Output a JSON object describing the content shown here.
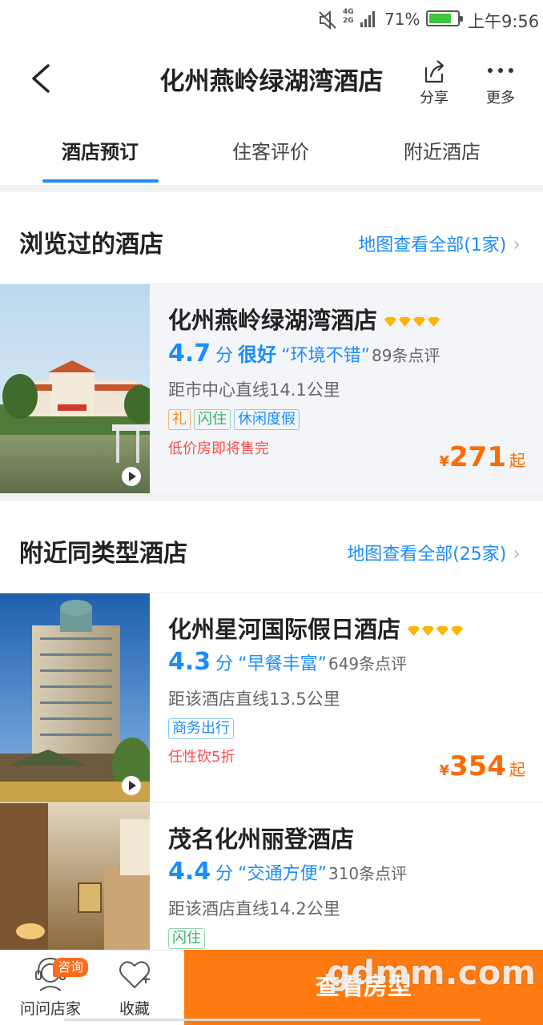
{
  "status_bar": {
    "network": "4G\n2G",
    "battery_percent": "71%",
    "battery_level": 0.71,
    "time": "上午9:56"
  },
  "header": {
    "title": "化州燕岭绿湖湾酒店",
    "share_label": "分享",
    "more_label": "更多"
  },
  "tabs": [
    {
      "label": "酒店预订",
      "active": true
    },
    {
      "label": "住客评价",
      "active": false
    },
    {
      "label": "附近酒店",
      "active": false
    }
  ],
  "viewed_section": {
    "title": "浏览过的酒店",
    "map_link": "地图查看全部(1家)"
  },
  "nearby_section": {
    "title": "附近同类型酒店",
    "map_link": "地图查看全部(25家)"
  },
  "hotels": [
    {
      "name": "化州燕岭绿湖湾酒店",
      "diamonds": 4,
      "score": "4.7",
      "score_unit": "分",
      "level": "很好",
      "highlight": "“环境不错”",
      "reviews": "89条点评",
      "distance": "距市中心直线14.1公里",
      "tags": [
        {
          "text": "礼",
          "color": "orange"
        },
        {
          "text": "闪住",
          "color": "green"
        },
        {
          "text": "休闲度假",
          "color": "blue"
        }
      ],
      "promo": "低价房即将售完",
      "price_symbol": "¥",
      "price": "271",
      "price_suffix": "起"
    },
    {
      "name": "化州星河国际假日酒店",
      "diamonds": 4,
      "score": "4.3",
      "score_unit": "分",
      "level": "",
      "highlight": "“早餐丰富”",
      "reviews": "649条点评",
      "distance": "距该酒店直线13.5公里",
      "tags": [
        {
          "text": "商务出行",
          "color": "blue"
        }
      ],
      "promo": "任性砍5折",
      "price_symbol": "¥",
      "price": "354",
      "price_suffix": "起"
    },
    {
      "name": "茂名化州丽登酒店",
      "diamonds": 0,
      "score": "4.4",
      "score_unit": "分",
      "level": "",
      "highlight": "“交通方便”",
      "reviews": "310条点评",
      "distance": "距该酒店直线14.2公里",
      "tags": [
        {
          "text": "闪住",
          "color": "green"
        }
      ],
      "promo": "",
      "price_symbol": "",
      "price": "",
      "price_suffix": ""
    }
  ],
  "bottom_bar": {
    "ask_label": "问问店家",
    "consult_badge": "咨询",
    "fav_label": "收藏",
    "view_rooms_label": "查看房型",
    "watermark": "gdmm.com"
  },
  "colors": {
    "accent_blue": "#1a8cff",
    "price_orange": "#ff6a00",
    "cta_orange": "#ff7a10",
    "promo_red": "#ff4b4b",
    "diamond_gold": "#ffb400"
  }
}
